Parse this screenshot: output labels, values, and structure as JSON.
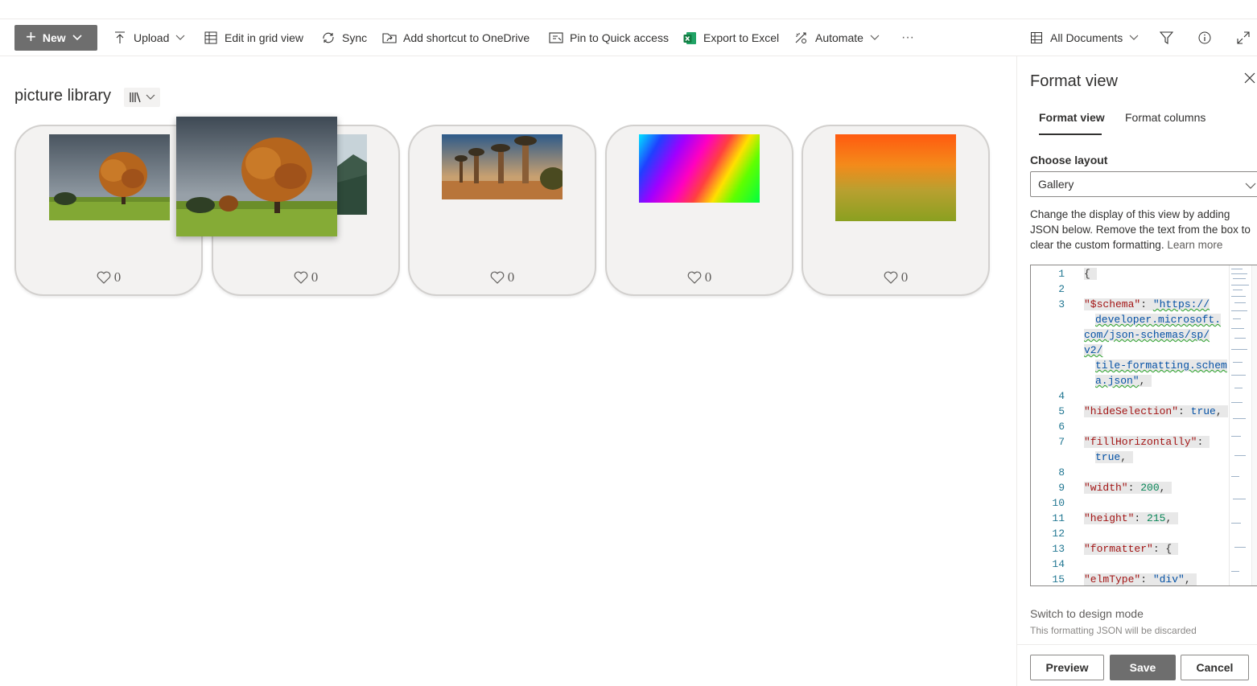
{
  "toolbar": {
    "new_label": "New",
    "upload_label": "Upload",
    "grid_label": "Edit in grid view",
    "sync_label": "Sync",
    "shortcut_label": "Add shortcut to OneDrive",
    "pin_label": "Pin to Quick access",
    "export_label": "Export to Excel",
    "automate_label": "Automate",
    "more_label": "···",
    "view_label": "All Documents"
  },
  "library": {
    "title": "picture library"
  },
  "tiles": [
    {
      "likes": "0",
      "image": "tree"
    },
    {
      "likes": "0",
      "image": "mountains"
    },
    {
      "likes": "0",
      "image": "baobabs"
    },
    {
      "likes": "0",
      "image": "rainbow"
    },
    {
      "likes": "0",
      "image": "orange-green-gradient"
    }
  ],
  "panel": {
    "title": "Format view",
    "tabs": [
      "Format view",
      "Format columns"
    ],
    "choose_layout_label": "Choose layout",
    "layout_value": "Gallery",
    "description": "Change the display of this view by adding JSON below. Remove the text from the box to clear the custom formatting.",
    "learn_more": "Learn more",
    "switch_link": "Switch to design mode",
    "switch_note": "This formatting JSON will be discarded",
    "preview_label": "Preview",
    "save_label": "Save",
    "cancel_label": "Cancel"
  },
  "editor": {
    "line_numbers": [
      "1",
      "2",
      "3",
      "4",
      "5",
      "6",
      "7",
      "8",
      "9",
      "10",
      "11",
      "12",
      "13",
      "14",
      "15"
    ],
    "schema_key": "\"$schema\"",
    "schema_url_1": "\"https://",
    "schema_url_2": "developer.microsoft.",
    "schema_url_3": "com/json-schemas/sp/",
    "schema_url_4": "v2/",
    "schema_url_5": "tile-formatting.schem",
    "schema_url_6": "a.json\"",
    "hide_key": "\"hideSelection\"",
    "hide_val": "true",
    "fill_key": "\"fillHorizontally\"",
    "fill_val": "true",
    "width_key": "\"width\"",
    "width_val": "200",
    "height_key": "\"height\"",
    "height_val": "215",
    "formatter_key": "\"formatter\"",
    "elm_key": "\"elmType\"",
    "elm_val": "\"div\""
  },
  "colors": {
    "brand_button": "#6e6e6e",
    "tile_bg": "#f3f2f1",
    "tile_border": "#d2d0ce"
  }
}
